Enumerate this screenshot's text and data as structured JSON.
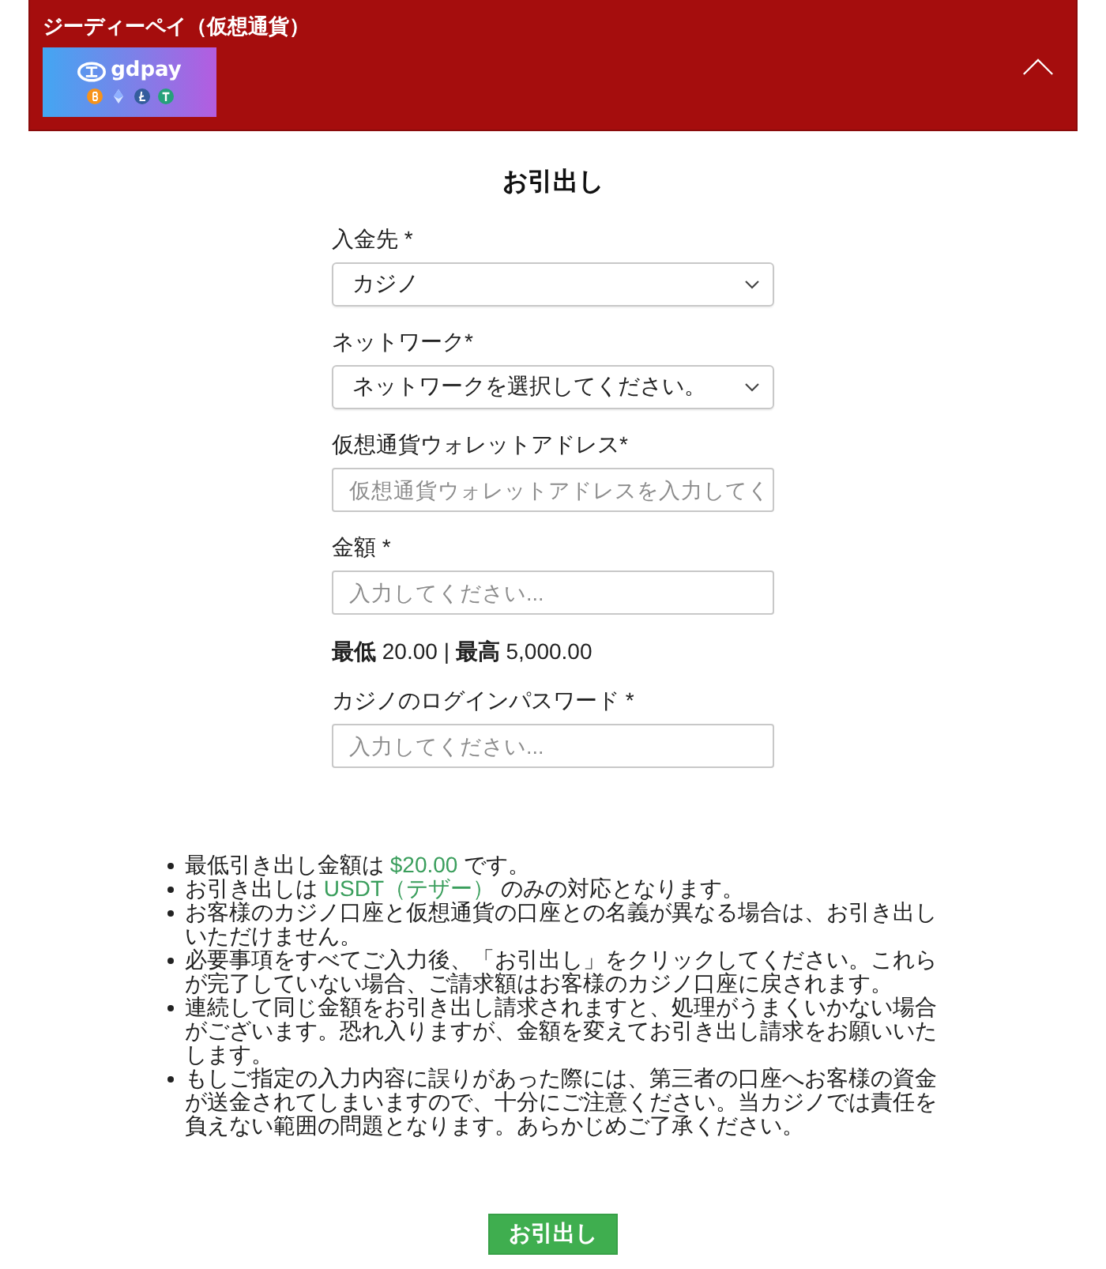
{
  "header": {
    "title": "ジーディーペイ（仮想通貨）",
    "logo": {
      "text": "gdpay"
    },
    "expanded": true
  },
  "form": {
    "title": "お引出し",
    "fields": [
      {
        "kind": "select",
        "label": "入金先 *",
        "value": "カジノ"
      },
      {
        "kind": "select",
        "label": "ネットワーク*",
        "value": "ネットワークを選択してください。"
      },
      {
        "kind": "input",
        "label": "仮想通貨ウォレットアドレス*",
        "placeholder": "仮想通貨ウォレットアドレスを入力してく"
      },
      {
        "kind": "input",
        "label": "金額 *",
        "placeholder": "入力してください..."
      },
      {
        "kind": "limits",
        "text": "**最低** 20.00 | **最高** 5,000.00"
      },
      {
        "kind": "input",
        "label": "カジノのログインパスワード *",
        "placeholder": "入力してください..."
      }
    ]
  },
  "notes": [
    {
      "segments": [
        {
          "kind": "plain",
          "text": "最低引き出し金額は "
        },
        {
          "kind": "highlight",
          "text": "$20.00"
        },
        {
          "kind": "plain",
          "text": " です。"
        }
      ]
    },
    {
      "segments": [
        {
          "kind": "plain",
          "text": "お引き出しは "
        },
        {
          "kind": "highlight",
          "text": "USDT（テザー）"
        },
        {
          "kind": "plain",
          "text": " のみの対応となります。"
        }
      ]
    },
    {
      "segments": [
        {
          "kind": "plain",
          "text": "お客様のカジノ口座と仮想通貨の口座との名義が異なる場合は、お引き出しいただけません。"
        }
      ]
    },
    {
      "segments": [
        {
          "kind": "plain",
          "text": "必要事項をすべてご入力後、「お引出し」をクリックしてください。これらが完了していない場合、ご請求額はお客様のカジノ口座に戻されます。"
        }
      ]
    },
    {
      "segments": [
        {
          "kind": "plain",
          "text": "連続して同じ金額をお引き出し請求されますと、処理がうまくいかない場合がございます。恐れ入りますが、金額を変えてお引き出し請求をお願いいたします。"
        }
      ]
    },
    {
      "segments": [
        {
          "kind": "plain",
          "text": "もしご指定の入力内容に誤りがあった際には、第三者の口座へお客様の資金が送金されてしまいますので、十分にご注意ください。当カジノでは責任を負えない範囲の問題となります。あらかじめご了承ください。"
        }
      ]
    }
  ],
  "submit_button": {
    "label": "お引出し"
  }
}
